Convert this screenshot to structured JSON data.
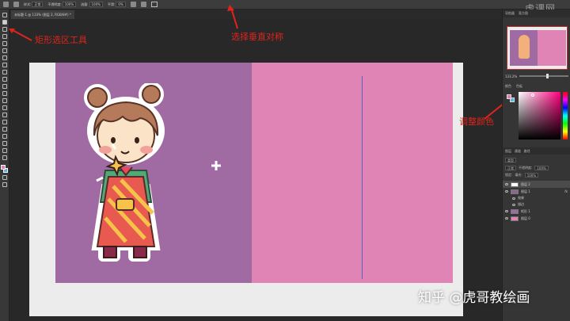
{
  "options_bar": {
    "mode_label": "样式:",
    "mode_value": "正常",
    "opacity_label": "不透明度:",
    "opacity_value": "100%",
    "flow_label": "流量:",
    "flow_value": "100%",
    "smooth_label": "平滑:",
    "smooth_value": "0%"
  },
  "top_watermark": "虎课网",
  "document_tab": "未标题-1 @ 133% (图层 2, RGB/8#) *",
  "annotations": {
    "rect_marquee": "矩形选区工具",
    "vertical_align": "选择垂直对称",
    "adjust_color": "调整颜色"
  },
  "panels": {
    "tabs": [
      "导航器",
      "直方图"
    ],
    "zoom_value": "133.2%",
    "color_tabs": [
      "颜色",
      "色板"
    ],
    "layers_tabs": [
      "图层",
      "通道",
      "路径"
    ],
    "kind_label": "类型",
    "blend_mode": "正常",
    "opacity_label": "不透明度:",
    "opacity_value": "100%",
    "lock_label": "锁定:",
    "fill_label": "填充:",
    "fill_value": "100%",
    "layers": [
      {
        "name": "图层 2",
        "selected": true
      },
      {
        "name": "图层 1",
        "selected": false,
        "fx": "fx"
      },
      {
        "name": "效果",
        "sub": true
      },
      {
        "name": "描边",
        "sub": true
      },
      {
        "name": "矩形 1",
        "selected": false
      },
      {
        "name": "图层 0",
        "selected": false
      }
    ]
  },
  "colors": {
    "left_half": "#a06aa3",
    "right_half": "#e083b5",
    "foreground": "#e07fb4",
    "background": "#5ab3e6",
    "annotation": "#e0241c"
  },
  "watermark": "知乎 @虎哥教绘画"
}
